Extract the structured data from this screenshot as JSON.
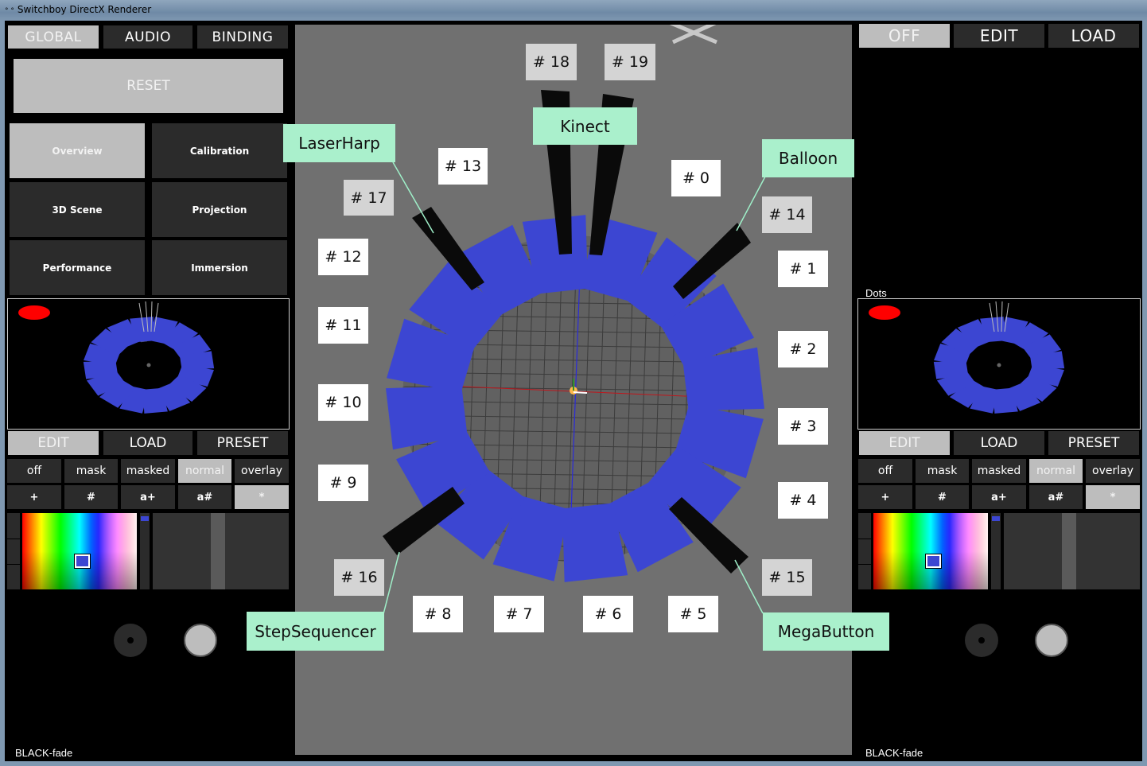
{
  "window": {
    "title": "Switchboy   DirectX Renderer"
  },
  "left_panel": {
    "tabs": [
      "GLOBAL",
      "AUDIO",
      "BINDING"
    ],
    "reset_label": "RESET",
    "menu": [
      "Overview",
      "Calibration",
      "3D Scene",
      "Projection",
      "Performance",
      "Immersion"
    ],
    "edit_tabs": [
      "EDIT",
      "LOAD",
      "PRESET"
    ],
    "modes": [
      "off",
      "mask",
      "masked",
      "normal",
      "overlay"
    ],
    "symbols": [
      "+",
      "#",
      "a+",
      "a#",
      "*"
    ],
    "status": "BLACK-fade"
  },
  "right_panel": {
    "tabs": [
      "OFF",
      "EDIT",
      "LOAD"
    ],
    "preview_title": "Dots",
    "edit_tabs": [
      "EDIT",
      "LOAD",
      "PRESET"
    ],
    "modes": [
      "off",
      "mask",
      "masked",
      "normal",
      "overlay"
    ],
    "symbols": [
      "+",
      "#",
      "a+",
      "a#",
      "*"
    ],
    "status": "BLACK-fade"
  },
  "scene": {
    "labels": {
      "n18": "# 18",
      "n19": "# 19",
      "n13": "# 13",
      "n0": "#  0",
      "n17": "# 17",
      "n14": "# 14",
      "n12": "#  12",
      "n1": "#  1",
      "n11": "#  11",
      "n2": "#  2",
      "n10": "#  10",
      "n3": "#  3",
      "n9": "#  9",
      "n4": "#  4",
      "n16": "# 16",
      "n15": "# 15",
      "n8": "#  8",
      "n7": "#  7",
      "n6": "#  6",
      "n5": "#  5"
    },
    "callouts": {
      "laserharp": "LaserHarp",
      "kinect": "Kinect",
      "balloon": "Balloon",
      "stepsequencer": "StepSequencer",
      "megabutton": "MegaButton"
    }
  },
  "colors": {
    "panel_blue": "#3c46d2",
    "callout_green": "#aaf0cc",
    "selected_grey": "#bdbdbd",
    "button_dark": "#2b2b2b",
    "viewport_grey": "#707070"
  }
}
